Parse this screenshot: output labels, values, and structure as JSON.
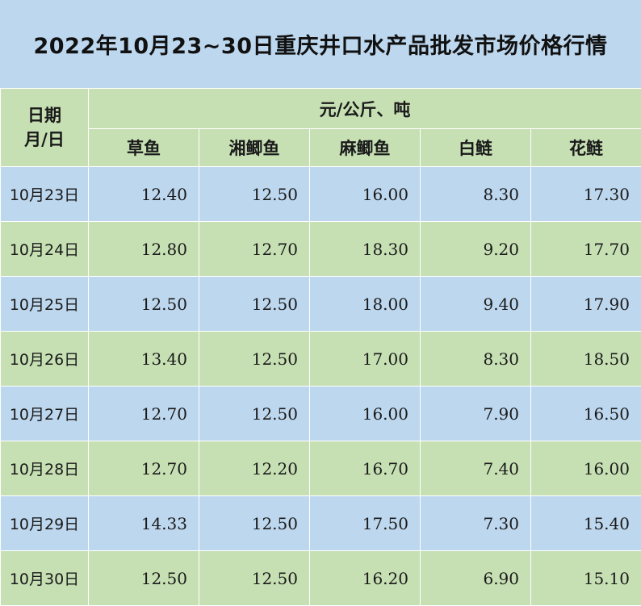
{
  "title": "2022年10月23~30日重庆井口水产品批发市场价格行情",
  "header": {
    "date_line1": "日期",
    "date_line2": "月/日",
    "unit": "元/公斤、吨",
    "columns": [
      "草鱼",
      "湘鲫鱼",
      "麻鲫鱼",
      "白鲢",
      "花鲢"
    ]
  },
  "rows": [
    {
      "date": "10月23日",
      "values": [
        "12.40",
        "12.50",
        "16.00",
        "8.30",
        "17.30"
      ]
    },
    {
      "date": "10月24日",
      "values": [
        "12.80",
        "12.70",
        "18.30",
        "9.20",
        "17.70"
      ]
    },
    {
      "date": "10月25日",
      "values": [
        "12.50",
        "12.50",
        "18.00",
        "9.40",
        "17.90"
      ]
    },
    {
      "date": "10月26日",
      "values": [
        "13.40",
        "12.50",
        "17.00",
        "8.30",
        "18.50"
      ]
    },
    {
      "date": "10月27日",
      "values": [
        "12.70",
        "12.50",
        "16.00",
        "7.90",
        "16.50"
      ]
    },
    {
      "date": "10月28日",
      "values": [
        "12.70",
        "12.20",
        "16.70",
        "7.40",
        "16.00"
      ]
    },
    {
      "date": "10月29日",
      "values": [
        "14.33",
        "12.50",
        "17.50",
        "7.30",
        "15.40"
      ]
    },
    {
      "date": "10月30日",
      "values": [
        "12.50",
        "12.50",
        "16.20",
        "6.90",
        "15.10"
      ]
    }
  ]
}
